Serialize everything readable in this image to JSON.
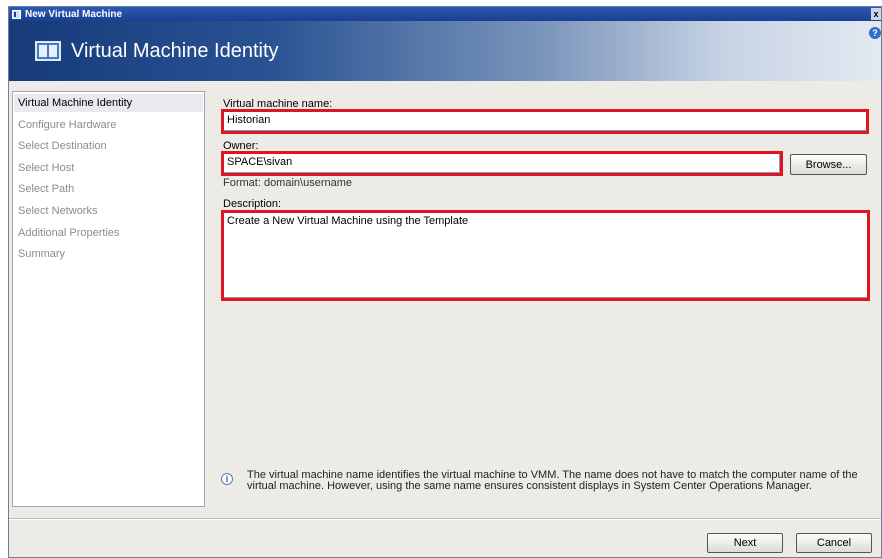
{
  "window": {
    "title": "New Virtual Machine",
    "close_glyph": "x"
  },
  "header": {
    "title": "Virtual Machine Identity",
    "help_glyph": "?"
  },
  "nav": {
    "items": [
      {
        "label": "Virtual Machine Identity",
        "active": true
      },
      {
        "label": "Configure Hardware",
        "active": false
      },
      {
        "label": "Select Destination",
        "active": false
      },
      {
        "label": "Select Host",
        "active": false
      },
      {
        "label": "Select Path",
        "active": false
      },
      {
        "label": "Select Networks",
        "active": false
      },
      {
        "label": "Additional Properties",
        "active": false
      },
      {
        "label": "Summary",
        "active": false
      }
    ]
  },
  "form": {
    "name_label": "Virtual machine name:",
    "name_value": "Historian",
    "owner_label": "Owner:",
    "owner_value": "SPACE\\sivan",
    "browse_label": "Browse...",
    "owner_format": "Format: domain\\username",
    "description_label": "Description:",
    "description_value": "Create a New Virtual Machine using the Template"
  },
  "info": {
    "icon": "info-icon",
    "text": "The virtual machine name identifies the virtual machine to VMM. The name does not have to match the computer name of the virtual machine. However, using the same name ensures consistent displays in System Center Operations Manager."
  },
  "footer": {
    "next_label": "Next",
    "cancel_label": "Cancel"
  },
  "colors": {
    "highlight": "#e0151f",
    "title_bar": "#1a3f91",
    "header_dark": "#163a7a"
  }
}
